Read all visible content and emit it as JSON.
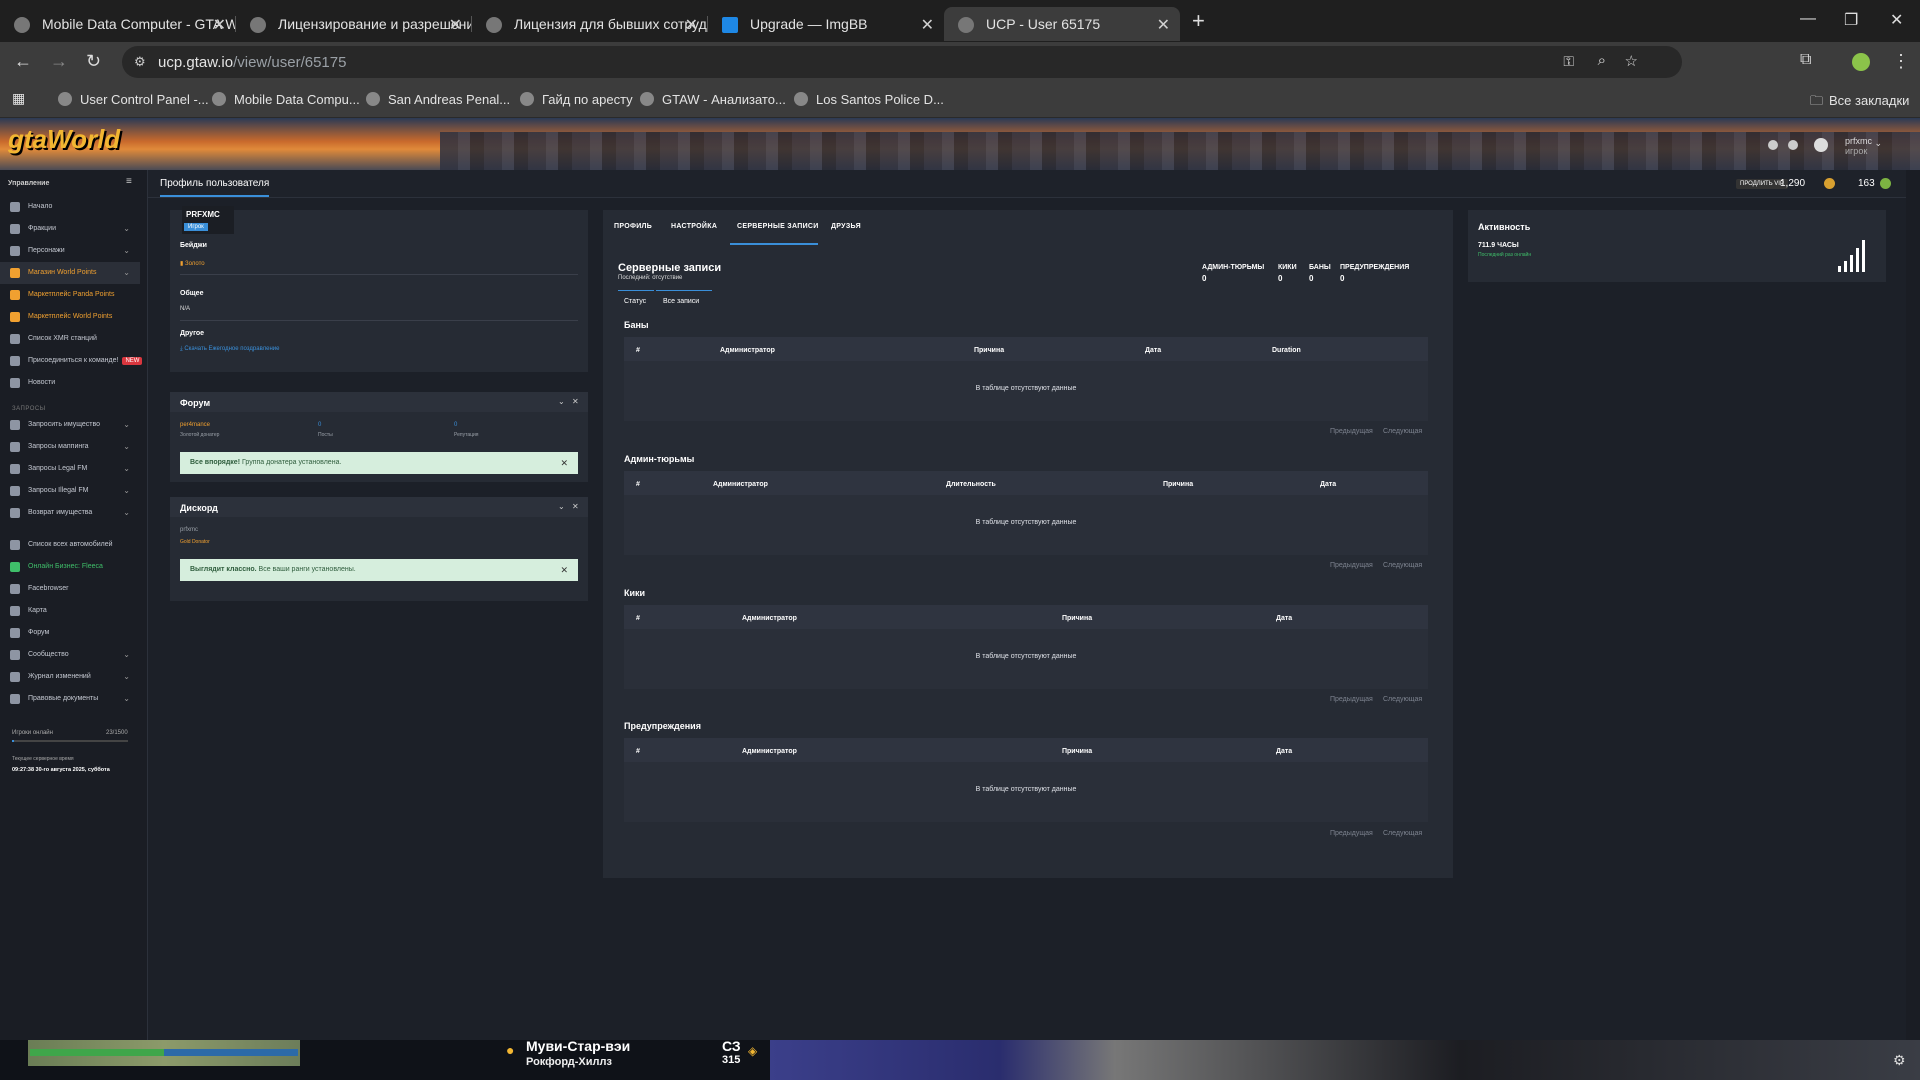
{
  "browser": {
    "tabs": [
      {
        "label": "Mobile Data Computer - GTA W"
      },
      {
        "label": "Лицензирование и разрешени"
      },
      {
        "label": "Лицензия для бывших сотруд"
      },
      {
        "label": "Upgrade — ImgBB"
      },
      {
        "label": "UCP - User 65175"
      }
    ],
    "url_host": "ucp.gtaw.io",
    "url_path": "/view/user/65175",
    "bookmarks": [
      "User Control Panel -...",
      "Mobile Data Compu...",
      "San Andreas Penal...",
      "Гайд по аресту",
      "GTAW - Анализато...",
      "Los Santos Police D..."
    ],
    "all_bookmarks": "Все закладки"
  },
  "header": {
    "logo_a": "gta",
    "logo_b": "World",
    "username": "prfxmc",
    "role": "игрок"
  },
  "sidebar": {
    "title": "Управление",
    "items": [
      "Начало",
      "Фракции",
      "Персонажи",
      "Магазин World Points",
      "Маркетплейс Panda Points",
      "Маркетплейс World Points",
      "Список XMR станций",
      "Присоединиться к команде!",
      "Новости"
    ],
    "badge": "NEW",
    "section_label": "ЗАПРОСЫ",
    "requests": [
      "Запросить имущество",
      "Запросы маппинга",
      "Запросы Legal FM",
      "Запросы Illegal FM",
      "Возврат имущества"
    ],
    "other": [
      "Список всех автомобилей",
      "Онлайн Бизнес: Fleeca",
      "Facebrowser",
      "Карта",
      "Форум",
      "Сообщество",
      "Журнал изменений",
      "Правовые документы"
    ],
    "players_online_label": "Игроки онлайн",
    "players_online_value": "23/1500",
    "server_time_label": "Текущее серверное время",
    "server_time_value": "09:27:38 30-го августа 2025, суббота"
  },
  "panelbar": {
    "title": "Профиль пользователя",
    "upgrade": "ПРОДЛИТЬ VIP",
    "points_a": "1,290",
    "points_b": "163"
  },
  "profile": {
    "name": "PRFXMC",
    "role": "Игрок",
    "badges_label": "Бейджи",
    "badge_value": "Золото",
    "general_label": "Общее",
    "general_value": "N/A",
    "other_label": "Другое",
    "other_link": "Скачать Ежегодное поздравление"
  },
  "forum": {
    "title": "Форум",
    "user": "per4mance",
    "user_role": "Золотой донатер",
    "posts_value": "0",
    "posts_label": "Посты",
    "rep_value": "0",
    "rep_label": "Репутация",
    "alert_bold": "Все впорядке!",
    "alert_text": "Группа донатера установлена."
  },
  "discord": {
    "title": "Дискорд",
    "user": "prfxmc",
    "role": "Gold Donator",
    "alert_bold": "Выглядит классно.",
    "alert_text": "Все ваши ранги установлены."
  },
  "records": {
    "tabs": [
      "ПРОФИЛЬ",
      "НАСТРОЙКА",
      "СЕРВЕРНЫЕ ЗАПИСИ",
      "ДРУЗЬЯ"
    ],
    "title": "Серверные записи",
    "subtitle": "Последний: отсутствие",
    "stats": [
      {
        "label": "АДМИН-ТЮРЬМЫ",
        "value": "0"
      },
      {
        "label": "КИКИ",
        "value": "0"
      },
      {
        "label": "БАНЫ",
        "value": "0"
      },
      {
        "label": "ПРЕДУПРЕЖДЕНИЯ",
        "value": "0"
      }
    ],
    "subtabs": [
      "Статус",
      "Все записи"
    ],
    "empty": "В таблице отсутствуют данные",
    "prev": "Предыдущая",
    "next": "Следующая",
    "bans": {
      "title": "Баны",
      "cols": [
        "#",
        "Администратор",
        "Причина",
        "Дата",
        "Duration"
      ]
    },
    "jails": {
      "title": "Админ-тюрьмы",
      "cols": [
        "#",
        "Администратор",
        "Длительность",
        "Причина",
        "Дата"
      ]
    },
    "kicks": {
      "title": "Кики",
      "cols": [
        "#",
        "Администратор",
        "Причина",
        "Дата"
      ]
    },
    "warns": {
      "title": "Предупреждения",
      "cols": [
        "#",
        "Администратор",
        "Причина",
        "Дата"
      ]
    }
  },
  "activity": {
    "title": "Активность",
    "hours": "711.9 ЧАСЫ",
    "status": "Последний раз онлайн"
  },
  "hud": {
    "street": "Муви-Стар-вэи",
    "area": "Рокфорд-Хиллз",
    "compass": "СЗ",
    "heading": "315"
  },
  "colors": {
    "accent": "#3a8fd9",
    "orange": "#f0a030",
    "green": "#3fbf6a"
  }
}
